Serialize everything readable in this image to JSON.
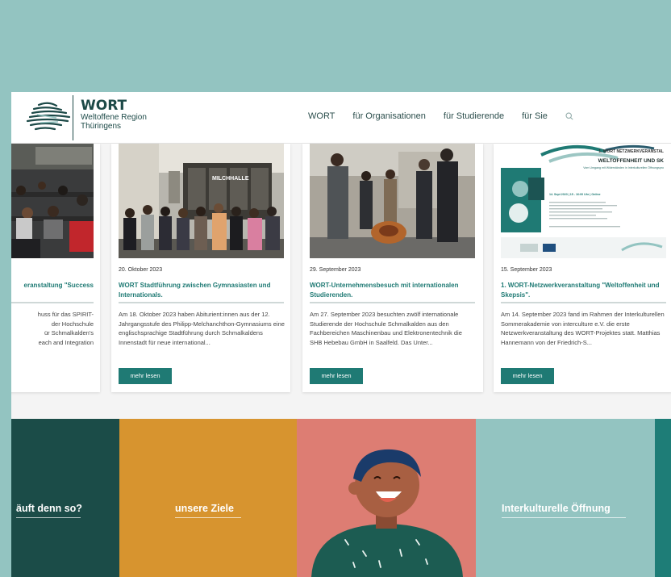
{
  "header": {
    "brand_title": "WORT",
    "brand_line1": "Weltoffene Region",
    "brand_line2": "Thüringens",
    "nav": [
      "WORT",
      "für Organisationen",
      "für Studierende",
      "für Sie"
    ]
  },
  "cards": [
    {
      "date": "",
      "title": "eranstaltung \"Success",
      "text": "huss für das SPIRIT-\nder Hochschule\nür Schmalkalden's\neach and Integration"
    },
    {
      "date": "20. Oktober 2023",
      "title": "WORT Stadtführung zwischen Gymnasiasten und Internationals.",
      "text": "Am 18. Oktober 2023 haben Abiturient:innen aus der 12. Jahrgangsstufe des Philipp-Melchanchthon-Gymnasiums eine englischsprachige Stadtführung durch Schmalkaldens Innenstadt für neue international...",
      "button": "mehr lesen",
      "photo_sign": "MILCHHALLE"
    },
    {
      "date": "29. September 2023",
      "title": "WORT-Unternehmensbesuch mit internationalen Studierenden.",
      "text": "Am 27. September 2023 besuchten zwölf internationale Studierende der Hochschule Schmalkalden aus den Fachbereichen Maschinenbau und Elektronentechnik die SHB Hebebau GmbH in Saalfeld.  Das Unter...",
      "button": "mehr lesen"
    },
    {
      "date": "15. September 2023",
      "title": "1. WORT-Netzwerkveranstaltung \"Weltoffenheit und Skepsis\".",
      "text": "Am 14. September 2023 fand im Rahmen der Interkulturellen Sommerakademie von interculture e.V. die erste Netzwerkveranstaltung des WORT-Projektes statt.  Matthias Hannemann von der Friedrich-S...",
      "button": "mehr lesen",
      "poster_line1": "1. WORT NETZWERKVERANSTAL",
      "poster_line2": "WELTOFFENHEIT UND SK",
      "poster_line3": "Vom Umgang mit Widerständen in Interkulturellen Öffnungspro",
      "poster_line4": "14. Sept 2023 | 15 - 16:00 Uhr | Online"
    }
  ],
  "tiles": [
    {
      "label": "äuft denn so?",
      "color": "#1b4c48"
    },
    {
      "label": "unsere Ziele",
      "color": "#d7942f"
    },
    {
      "label": "",
      "color": "#dd7d73"
    },
    {
      "label": "Interkulturelle Öffnung",
      "color": "#93c4c1"
    },
    {
      "label": "",
      "color": "#1e7d77"
    }
  ],
  "colors": {
    "background": "#93c4c1",
    "accent": "#1f7a74",
    "dark_green": "#1b4c48"
  }
}
